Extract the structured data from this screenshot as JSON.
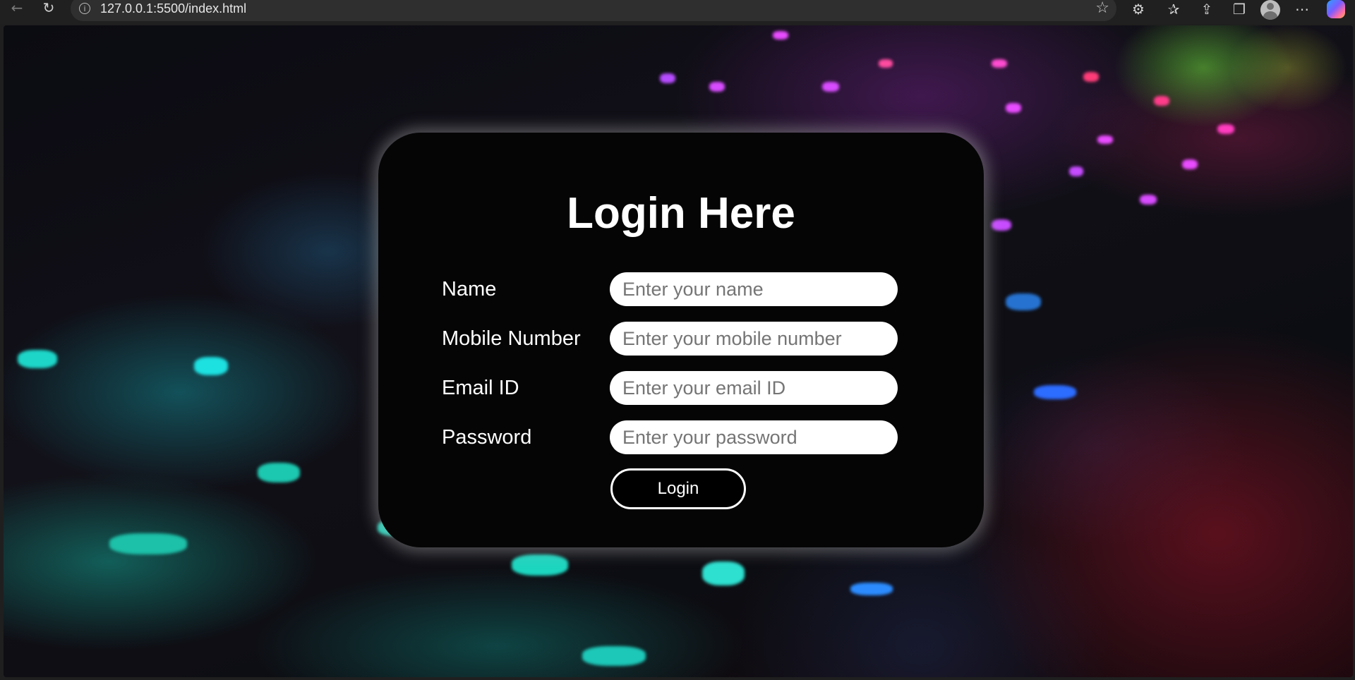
{
  "browser": {
    "url": "127.0.0.1:5500/index.html",
    "back_icon": "arrow-left-icon",
    "reload_icon": "reload-icon",
    "info_icon": "info-icon",
    "favorite_icon": "star-icon",
    "extensions_icon": "puzzle-icon",
    "favorites_icon": "favorites-list-icon",
    "share_icon": "share-icon",
    "collections_icon": "collections-icon",
    "profile_icon": "profile-avatar-icon",
    "menu_icon": "more-icon",
    "copilot_icon": "copilot-icon"
  },
  "login": {
    "title": "Login Here",
    "fields": [
      {
        "label": "Name",
        "placeholder": "Enter your name",
        "type": "text"
      },
      {
        "label": "Mobile Number",
        "placeholder": "Enter your mobile number",
        "type": "tel"
      },
      {
        "label": "Email ID",
        "placeholder": "Enter your email ID",
        "type": "email"
      },
      {
        "label": "Password",
        "placeholder": "Enter your password",
        "type": "password"
      }
    ],
    "submit_label": "Login"
  },
  "colors": {
    "card_background": "#050505",
    "text": "#ffffff",
    "input_background": "#ffffff",
    "button_border": "#ffffff"
  }
}
